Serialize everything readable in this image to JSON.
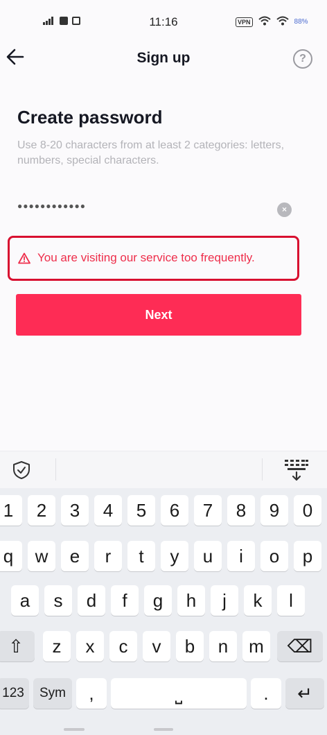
{
  "status_bar": {
    "time": "11:16",
    "vpn": "VPN",
    "battery": "88%"
  },
  "nav": {
    "title": "Sign up",
    "help": "?"
  },
  "form": {
    "heading": "Create password",
    "hint": "Use 8-20 characters from at least 2 categories: letters, numbers, special characters.",
    "password_value": "●●●●●●●●●●●●",
    "clear_symbol": "×"
  },
  "error": {
    "message": "You are visiting our service too frequently."
  },
  "next_button": {
    "label": "Next"
  },
  "keyboard": {
    "number_row": [
      "1",
      "2",
      "3",
      "4",
      "5",
      "6",
      "7",
      "8",
      "9",
      "0"
    ],
    "row1": [
      "q",
      "w",
      "e",
      "r",
      "t",
      "y",
      "u",
      "i",
      "o",
      "p"
    ],
    "row2": [
      "a",
      "s",
      "d",
      "f",
      "g",
      "h",
      "j",
      "k",
      "l"
    ],
    "row3": [
      "z",
      "x",
      "c",
      "v",
      "b",
      "n",
      "m"
    ],
    "shift": "⇧",
    "backspace": "⌫",
    "mode_123": "123",
    "mode_sym": "Sym",
    "comma": ",",
    "space": "⎵",
    "period": ".",
    "enter": "↵"
  },
  "colors": {
    "accent": "#fe2c55",
    "error": "#ee2d4a",
    "highlight_border": "#d81030"
  }
}
